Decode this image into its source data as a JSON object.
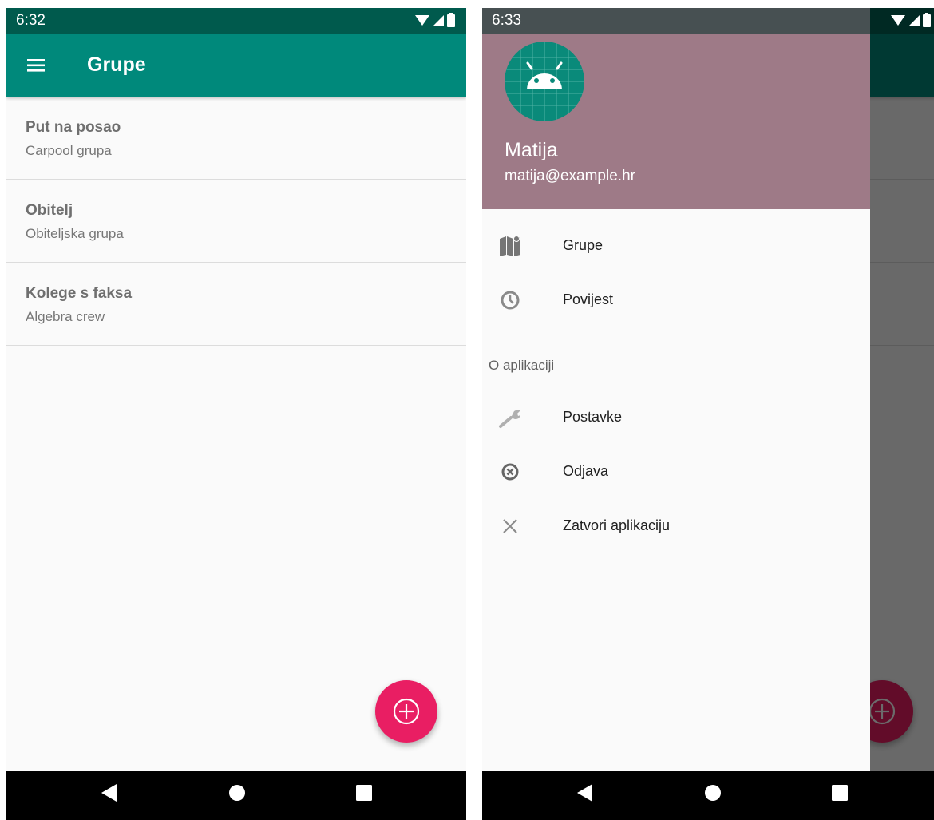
{
  "left_screen": {
    "status": {
      "time": "6:32"
    },
    "appbar": {
      "title": "Grupe"
    },
    "groups": [
      {
        "name": "Put na posao",
        "description": "Carpool grupa"
      },
      {
        "name": "Obitelj",
        "description": "Obiteljska grupa"
      },
      {
        "name": "Kolege s faksa",
        "description": "Algebra crew"
      }
    ]
  },
  "right_screen": {
    "status": {
      "time": "6:33"
    },
    "profile": {
      "name": "Matija",
      "email": "matija@example.hr"
    },
    "menu": {
      "items": [
        {
          "label": "Grupe",
          "icon": "map-icon"
        },
        {
          "label": "Povijest",
          "icon": "clock-icon"
        }
      ],
      "section_title": "O aplikaciji",
      "section_items": [
        {
          "label": "Postavke",
          "icon": "wrench-icon"
        },
        {
          "label": "Odjava",
          "icon": "logout-circle-icon"
        },
        {
          "label": "Zatvori aplikaciju",
          "icon": "close-icon"
        }
      ]
    }
  },
  "colors": {
    "status_bar": "#005a4d",
    "app_bar": "#00897b",
    "fab": "#e91e63",
    "drawer_header": "#9e7a87"
  }
}
